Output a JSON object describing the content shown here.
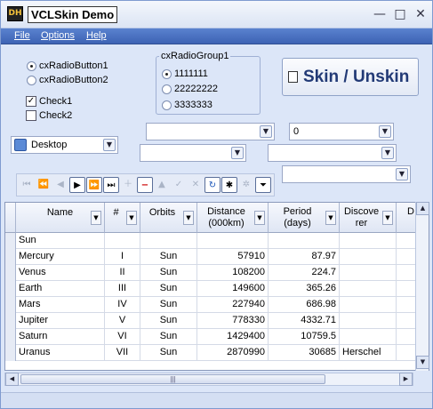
{
  "window": {
    "title": "VCLSkin Demo",
    "app_icon_text": "DH",
    "minimize_glyph": "—",
    "maximize_glyph": "□",
    "close_glyph": "✕"
  },
  "menu": [
    "File",
    "Options",
    "Help"
  ],
  "radios": [
    {
      "label": "cxRadioButton1",
      "checked": true
    },
    {
      "label": "cxRadioButton2",
      "checked": false
    }
  ],
  "checks": [
    {
      "label": "Check1",
      "checked": true
    },
    {
      "label": "Check2",
      "checked": false
    }
  ],
  "radio_group": {
    "caption": "cxRadioGroup1",
    "items": [
      "1111111",
      "22222222",
      "3333333"
    ],
    "selected": 0
  },
  "skin_button": "Skin / Unskin",
  "combos": {
    "desktop": "Desktop",
    "combo_a": "",
    "combo_b": "0",
    "combo_c": "",
    "combo_d": "",
    "combo_e": ""
  },
  "navigator": [
    "first",
    "prior-page",
    "prior",
    "next",
    "next-page",
    "last",
    "insert",
    "delete",
    "edit",
    "post",
    "cancel",
    "refresh",
    "bookmark",
    "goto-bookmark",
    "filter"
  ],
  "grid": {
    "columns": [
      {
        "label": "Name"
      },
      {
        "label": "#"
      },
      {
        "label": "Orbits"
      },
      {
        "label": "Distance\n(000km)"
      },
      {
        "label": "Period\n(days)"
      },
      {
        "label": "Discove\nrer"
      },
      {
        "label": "D"
      }
    ],
    "rows": [
      [
        "Sun",
        "",
        "",
        "",
        "",
        ""
      ],
      [
        "Mercury",
        "I",
        "Sun",
        "57910",
        "87.97",
        ""
      ],
      [
        "Venus",
        "II",
        "Sun",
        "108200",
        "224.7",
        ""
      ],
      [
        "Earth",
        "III",
        "Sun",
        "149600",
        "365.26",
        ""
      ],
      [
        "Mars",
        "IV",
        "Sun",
        "227940",
        "686.98",
        ""
      ],
      [
        "Jupiter",
        "V",
        "Sun",
        "778330",
        "4332.71",
        ""
      ],
      [
        "Saturn",
        "VI",
        "Sun",
        "1429400",
        "10759.5",
        ""
      ],
      [
        "Uranus",
        "VII",
        "Sun",
        "2870990",
        "30685",
        "Herschel"
      ]
    ]
  }
}
